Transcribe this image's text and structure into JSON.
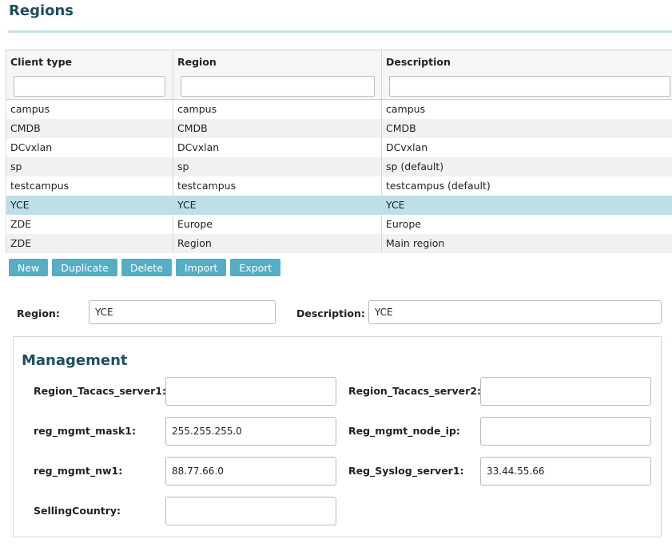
{
  "page": {
    "title": "Regions"
  },
  "table": {
    "columns": [
      {
        "label": "Client type"
      },
      {
        "label": "Region"
      },
      {
        "label": "Description"
      }
    ],
    "rows": [
      [
        "campus",
        "campus",
        "campus"
      ],
      [
        "CMDB",
        "CMDB",
        "CMDB"
      ],
      [
        "DCvxlan",
        "DCvxlan",
        "DCvxlan"
      ],
      [
        "sp",
        "sp",
        "sp (default)"
      ],
      [
        "testcampus",
        "testcampus",
        "testcampus (default)"
      ],
      [
        "YCE",
        "YCE",
        "YCE"
      ],
      [
        "ZDE",
        "Europe",
        "Europe"
      ],
      [
        "ZDE",
        "Region",
        "Main region"
      ]
    ],
    "selected_row": 5
  },
  "toolbar": {
    "new_label": "New",
    "duplicate_label": "Duplicate",
    "delete_label": "Delete",
    "import_label": "Import",
    "export_label": "Export"
  },
  "form": {
    "region_label": "Region:",
    "region_value": "YCE",
    "description_label": "Description:",
    "description_value": "YCE"
  },
  "management": {
    "title": "Management",
    "tacacs1_label": "Region_Tacacs_server1:",
    "tacacs1_value": "",
    "tacacs2_label": "Region_Tacacs_server2:",
    "tacacs2_value": "",
    "mask1_label": "reg_mgmt_mask1:",
    "mask1_value": "255.255.255.0",
    "node_ip_label": "Reg_mgmt_node_ip:",
    "node_ip_value": "",
    "nw1_label": "reg_mgmt_nw1:",
    "nw1_value": "88.77.66.0",
    "syslog1_label": "Reg_Syslog_server1:",
    "syslog1_value": "33.44.55.66",
    "selling_country_label": "SellingCountry:",
    "selling_country_value": ""
  },
  "colors": {
    "accent": "#55aec4",
    "title": "#1f4f5f",
    "selected_row": "#bde0e8"
  }
}
